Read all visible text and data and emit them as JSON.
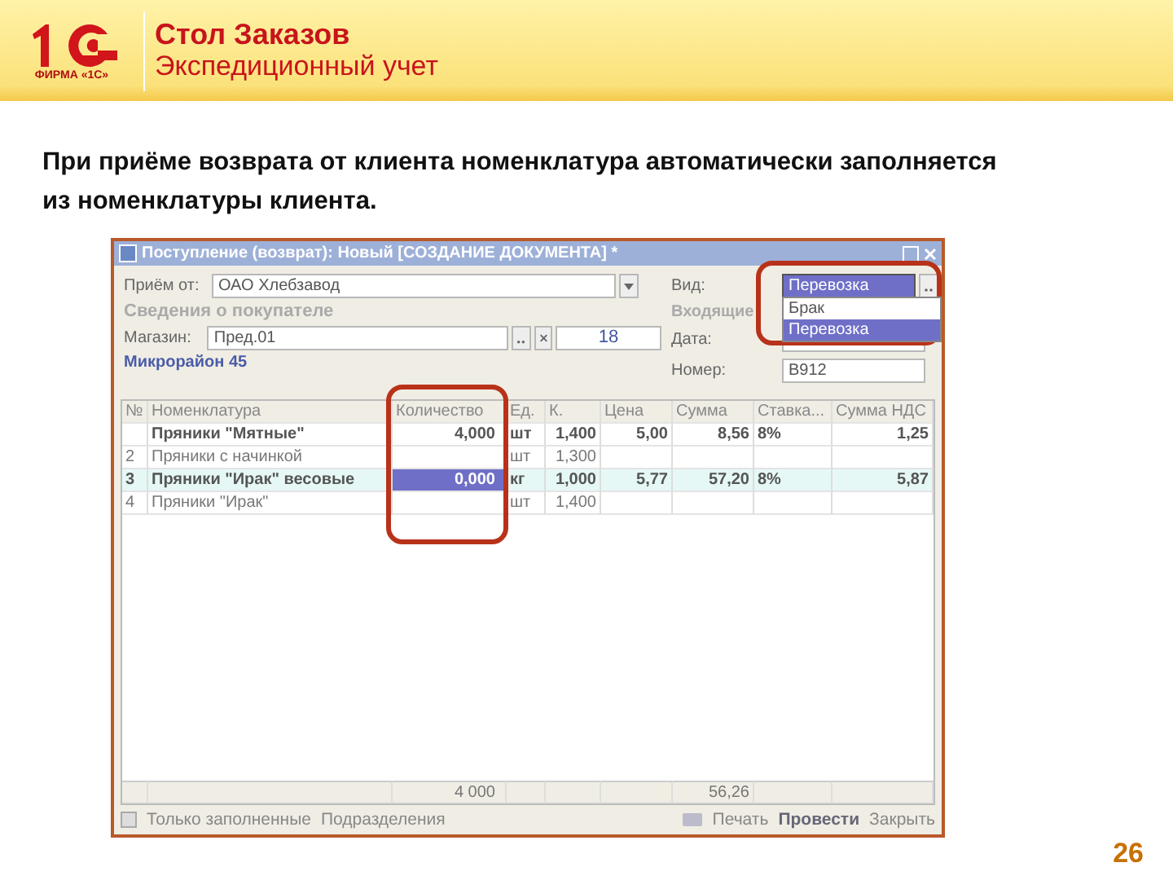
{
  "header": {
    "logo_caption": "ФИРМА «1С»",
    "title": "Стол Заказов",
    "subtitle": "Экспедиционный учет"
  },
  "description": "При приёме возврата от клиента номенклатура автоматически заполняется из номенклатуры клиента.",
  "window": {
    "title": "Поступление (возврат): Новый [СОЗДАНИЕ ДОКУМЕНТА] *",
    "left_fields": [
      {
        "label": "Приём от:",
        "value": "ОАО Хлебзавод"
      }
    ],
    "group_title": "Сведения о покупателе",
    "shop": {
      "label": "Магазин:",
      "value": "Пред.01",
      "number": "18"
    },
    "district": "Микрорайон 45",
    "kind": {
      "label": "Вид:",
      "value": "Перевозка",
      "options": [
        {
          "label": "Брак",
          "selected": false
        },
        {
          "label": "Перевозка",
          "selected": true
        }
      ]
    },
    "incoming_title": "Входящие",
    "right_fields": [
      {
        "label": "Дата:"
      },
      {
        "label": "Номер:",
        "value": "В912"
      }
    ],
    "table": {
      "columns": [
        "№",
        "Номенклатура",
        "Количество",
        "Ед.",
        "К.",
        "Цена",
        "Сумма",
        "Ставка...",
        "Сумма НДС"
      ],
      "rows": [
        {
          "cells": [
            "",
            "Пряники \"Мятные\"",
            "4,000",
            "шт",
            "1,400",
            "5,00",
            "8,56",
            "8%",
            "1,25"
          ],
          "bold": true,
          "selected": false
        },
        {
          "cells": [
            "2",
            "Пряники с начинкой",
            "",
            "шт",
            "1,300",
            "",
            "",
            "",
            ""
          ],
          "bold": false,
          "selected": false
        },
        {
          "cells": [
            "3",
            "Пряники \"Ирак\" весовые",
            "0,000",
            "кг",
            "1,000",
            "5,77",
            "57,20",
            "8%",
            "5,87"
          ],
          "bold": true,
          "selected": true
        },
        {
          "cells": [
            "4",
            "Пряники \"Ирак\"",
            "",
            "шт",
            "1,400",
            "",
            "",
            "",
            ""
          ],
          "bold": false,
          "selected": false
        }
      ],
      "totals": {
        "quantity": "4 000",
        "sum": "56,26"
      }
    },
    "toolbar_left": [
      "Только заполненные",
      "Подразделения"
    ],
    "toolbar_right": [
      {
        "label": "Печать",
        "kind": "print"
      },
      {
        "label": "Провести",
        "kind": "bold"
      },
      {
        "label": "Закрыть",
        "kind": "plain"
      }
    ]
  },
  "page_number": "26"
}
